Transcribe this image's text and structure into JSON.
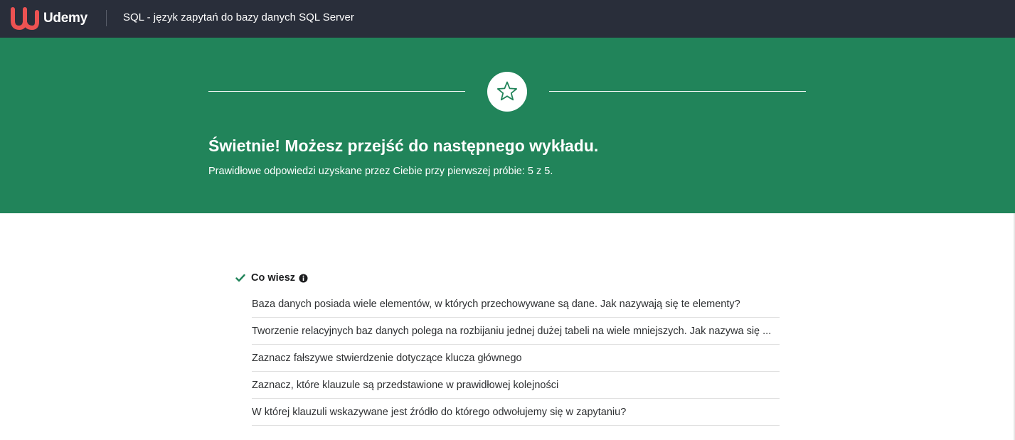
{
  "header": {
    "brand": "Udemy",
    "course_title": "SQL - język zapytań do bazy danych SQL Server",
    "logo_icon": "udemy-logo-icon",
    "logo_color": "#ec5252",
    "background": "#292e3a"
  },
  "result": {
    "icon": "star-icon",
    "background": "#21845a",
    "title": "Świetnie! Możesz przejść do następnego wykładu.",
    "subtitle": "Prawidłowe odpowiedzi uzyskane przez Ciebie przy pierwszej próbie: 5 z 5."
  },
  "section": {
    "status_icon": "check-icon",
    "status_color": "#21845a",
    "title": "Co wiesz",
    "info_icon": "info-icon",
    "questions": [
      "Baza danych posiada wiele elementów, w których przechowywane są dane. Jak nazywają się te elementy?",
      "Tworzenie relacyjnych baz danych polega na rozbijaniu jednej dużej tabeli na wiele mniejszych. Jak nazywa się ...",
      "Zaznacz fałszywe stwierdzenie dotyczące klucza głównego",
      "Zaznacz, które klauzule są przedstawione w prawidłowej kolejności",
      "W której klauzuli wskazywane jest źródło do którego odwołujemy się w zapytaniu?"
    ]
  }
}
